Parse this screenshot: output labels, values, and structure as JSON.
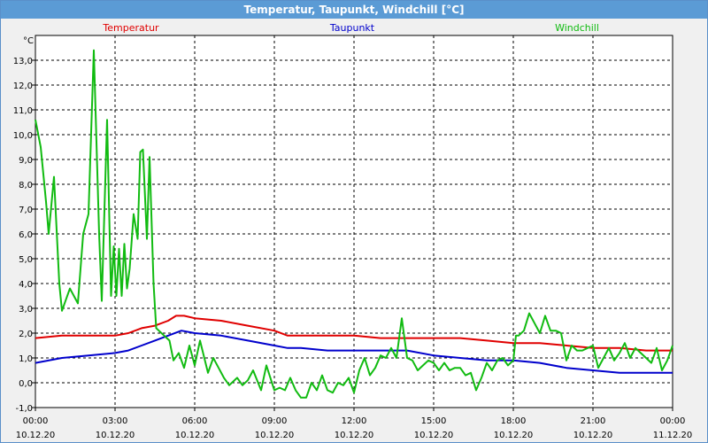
{
  "window": {
    "title": "Temperatur, Taupunkt, Windchill [°C]"
  },
  "chart_data": {
    "type": "line",
    "title": "Temperatur, Taupunkt, Windchill [°C]",
    "ylabel": "°C",
    "xlabel": "",
    "ylim": [
      -1.0,
      14.0
    ],
    "xlim_hours": [
      0,
      24
    ],
    "grid": true,
    "legend_placement": "top",
    "y_ticks": [
      "-1,0",
      "0,0",
      "1,0",
      "2,0",
      "3,0",
      "4,0",
      "5,0",
      "6,0",
      "7,0",
      "8,0",
      "9,0",
      "10,0",
      "11,0",
      "12,0",
      "13,0"
    ],
    "x_ticks": [
      {
        "time": "00:00",
        "date": "10.12.20"
      },
      {
        "time": "03:00",
        "date": "10.12.20"
      },
      {
        "time": "06:00",
        "date": "10.12.20"
      },
      {
        "time": "09:00",
        "date": "10.12.20"
      },
      {
        "time": "12:00",
        "date": "10.12.20"
      },
      {
        "time": "15:00",
        "date": "10.12.20"
      },
      {
        "time": "18:00",
        "date": "10.12.20"
      },
      {
        "time": "21:00",
        "date": "10.12.20"
      },
      {
        "time": "00:00",
        "date": "11.12.20"
      }
    ],
    "series": [
      {
        "name": "Temperatur",
        "color": "#e00000",
        "x": [
          0,
          1,
          2,
          3,
          3.5,
          4,
          4.5,
          5,
          5.3,
          5.6,
          6,
          7,
          8,
          9,
          9.5,
          10,
          11,
          12,
          13,
          14,
          15,
          16,
          17,
          18,
          19,
          20,
          21,
          22,
          23,
          24
        ],
        "y": [
          1.8,
          1.9,
          1.9,
          1.9,
          2.0,
          2.2,
          2.3,
          2.5,
          2.7,
          2.7,
          2.6,
          2.5,
          2.3,
          2.1,
          1.9,
          1.9,
          1.9,
          1.9,
          1.8,
          1.8,
          1.8,
          1.8,
          1.7,
          1.6,
          1.6,
          1.5,
          1.4,
          1.4,
          1.3,
          1.3
        ]
      },
      {
        "name": "Taupunkt",
        "color": "#0000cc",
        "x": [
          0,
          1,
          2,
          3,
          3.5,
          4,
          4.5,
          5,
          5.5,
          6,
          7,
          8,
          9,
          9.5,
          10,
          11,
          12,
          13,
          14,
          15,
          16,
          17,
          18,
          19,
          20,
          21,
          22,
          23,
          24
        ],
        "y": [
          0.8,
          1.0,
          1.1,
          1.2,
          1.3,
          1.5,
          1.7,
          1.9,
          2.1,
          2.0,
          1.9,
          1.7,
          1.5,
          1.4,
          1.4,
          1.3,
          1.3,
          1.3,
          1.3,
          1.1,
          1.0,
          0.9,
          0.9,
          0.8,
          0.6,
          0.5,
          0.4,
          0.4,
          0.4
        ]
      },
      {
        "name": "Windchill",
        "color": "#11bb11",
        "x": [
          0,
          0.2,
          0.4,
          0.5,
          0.7,
          0.9,
          1.0,
          1.3,
          1.6,
          1.8,
          2.0,
          2.2,
          2.4,
          2.5,
          2.7,
          2.85,
          2.95,
          3.05,
          3.15,
          3.25,
          3.35,
          3.45,
          3.55,
          3.7,
          3.85,
          3.95,
          4.05,
          4.2,
          4.3,
          4.45,
          4.55,
          4.65,
          4.75,
          4.85,
          4.95,
          5.05,
          5.2,
          5.4,
          5.6,
          5.8,
          6.0,
          6.2,
          6.5,
          6.7,
          6.9,
          7.1,
          7.3,
          7.6,
          7.8,
          8.0,
          8.2,
          8.5,
          8.7,
          9.0,
          9.2,
          9.4,
          9.6,
          9.8,
          10.0,
          10.2,
          10.4,
          10.6,
          10.8,
          11.0,
          11.2,
          11.4,
          11.6,
          11.8,
          12.0,
          12.2,
          12.4,
          12.6,
          12.8,
          13.0,
          13.2,
          13.4,
          13.6,
          13.8,
          14.0,
          14.2,
          14.4,
          14.6,
          14.8,
          15.0,
          15.2,
          15.4,
          15.6,
          15.8,
          16.0,
          16.2,
          16.4,
          16.6,
          16.8,
          17.0,
          17.2,
          17.4,
          17.6,
          17.8,
          18.0,
          18.1,
          18.2,
          18.4,
          18.6,
          18.8,
          19.0,
          19.2,
          19.4,
          19.6,
          19.8,
          20.0,
          20.2,
          20.4,
          20.6,
          20.8,
          21.0,
          21.2,
          21.4,
          21.6,
          21.8,
          22.0,
          22.2,
          22.4,
          22.6,
          22.8,
          23.0,
          23.2,
          23.4,
          23.6,
          23.8,
          24.0
        ],
        "y": [
          10.6,
          9.5,
          7.3,
          6.0,
          8.3,
          4.0,
          2.9,
          3.8,
          3.2,
          6.0,
          6.8,
          13.4,
          6.0,
          3.3,
          10.6,
          3.5,
          5.5,
          3.5,
          5.4,
          3.5,
          5.6,
          3.8,
          4.6,
          6.8,
          5.8,
          9.3,
          9.4,
          5.8,
          9.1,
          4.0,
          2.2,
          2.1,
          2.0,
          1.9,
          1.8,
          1.7,
          0.9,
          1.2,
          0.6,
          1.5,
          0.7,
          1.7,
          0.4,
          1.0,
          0.6,
          0.2,
          -0.1,
          0.2,
          -0.1,
          0.1,
          0.5,
          -0.3,
          0.7,
          -0.3,
          -0.2,
          -0.3,
          0.2,
          -0.3,
          -0.6,
          -0.6,
          0.0,
          -0.3,
          0.3,
          -0.3,
          -0.4,
          0.0,
          -0.1,
          0.2,
          -0.4,
          0.5,
          1.0,
          0.3,
          0.6,
          1.1,
          1.0,
          1.4,
          1.0,
          2.6,
          1.0,
          0.9,
          0.5,
          0.7,
          0.9,
          0.8,
          0.5,
          0.8,
          0.5,
          0.6,
          0.6,
          0.3,
          0.4,
          -0.3,
          0.2,
          0.8,
          0.5,
          0.9,
          1.0,
          0.7,
          0.9,
          1.9,
          1.9,
          2.1,
          2.8,
          2.4,
          2.0,
          2.7,
          2.1,
          2.1,
          2.0,
          0.9,
          1.5,
          1.3,
          1.3,
          1.4,
          1.5,
          0.6,
          1.0,
          1.4,
          0.9,
          1.2,
          1.6,
          1.0,
          1.4,
          1.2,
          1.0,
          0.8,
          1.4,
          0.5,
          0.9,
          1.5
        ]
      }
    ]
  }
}
